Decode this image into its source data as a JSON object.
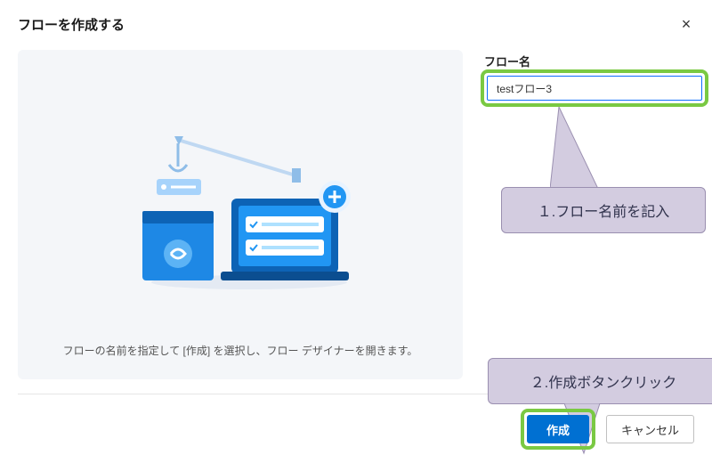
{
  "header": {
    "title": "フローを作成する",
    "close_label": "×"
  },
  "left": {
    "caption": "フローの名前を指定して [作成] を選択し、フロー デザイナーを開きます。"
  },
  "form": {
    "flow_name_label": "フロー名",
    "flow_name_value": "testフロー3"
  },
  "annotations": {
    "step1": "１.フロー名前を記入",
    "step2": "２.作成ボタンクリック"
  },
  "footer": {
    "create": "作成",
    "cancel": "キャンセル"
  },
  "colors": {
    "highlight_border": "#7ac943",
    "primary_button": "#0070d2",
    "callout_bg": "#d3cce0",
    "callout_border": "#9a8fb0"
  }
}
